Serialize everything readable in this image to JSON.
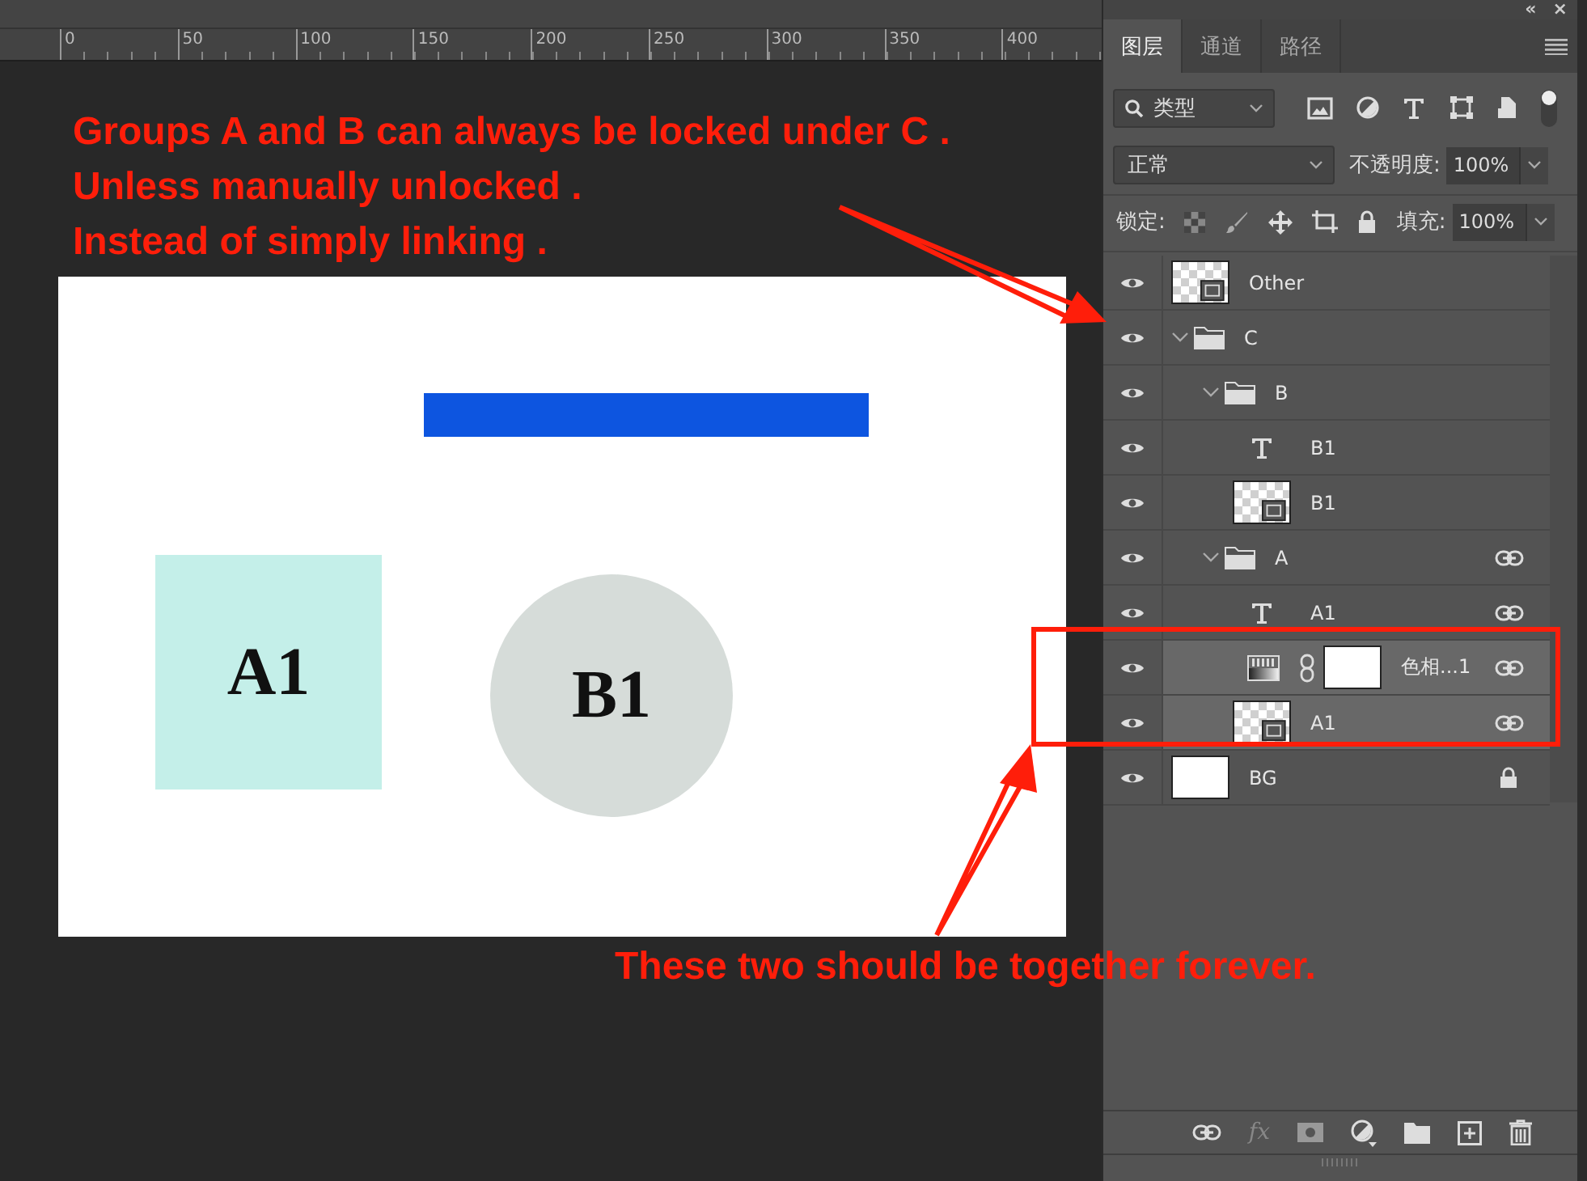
{
  "ruler": {
    "ticks": [
      "0",
      "50",
      "100",
      "150",
      "200",
      "250",
      "300",
      "350",
      "400"
    ]
  },
  "canvas": {
    "shapes": [
      {
        "kind": "bar"
      },
      {
        "kind": "square",
        "label": "A1"
      },
      {
        "kind": "circle",
        "label": "B1"
      }
    ]
  },
  "panel": {
    "header_buttons": [
      "«",
      "×"
    ],
    "tabs": [
      {
        "label": "图层",
        "selected": true
      },
      {
        "label": "通道",
        "selected": false
      },
      {
        "label": "路径",
        "selected": false
      }
    ],
    "filter": {
      "value": "类型"
    },
    "blend_mode": "正常",
    "opacity_label": "不透明度:",
    "opacity": "100%",
    "lock_label": "锁定:",
    "fill_label": "填充:",
    "fill": "100%",
    "layers": [
      {
        "kind": "shape",
        "name": "Other",
        "selected": false,
        "linked": false,
        "locked": false
      },
      {
        "kind": "group",
        "name": "C",
        "expanded": true,
        "selected": false,
        "linked": false,
        "locked": false,
        "children": [
          {
            "kind": "group",
            "name": "B",
            "expanded": true,
            "selected": false,
            "linked": false,
            "locked": false,
            "children": [
              {
                "kind": "text",
                "name": "B1",
                "selected": false,
                "linked": false,
                "locked": false
              },
              {
                "kind": "shape",
                "name": "B1",
                "selected": false,
                "linked": false,
                "locked": false
              }
            ]
          },
          {
            "kind": "group",
            "name": "A",
            "expanded": true,
            "selected": false,
            "linked": true,
            "locked": false,
            "children": [
              {
                "kind": "text",
                "name": "A1",
                "selected": false,
                "linked": true,
                "locked": false
              },
              {
                "kind": "adjustment",
                "name": "色相...1",
                "selected": true,
                "linked": true,
                "locked": false
              },
              {
                "kind": "shape",
                "name": "A1",
                "selected": true,
                "linked": true,
                "locked": false
              }
            ]
          }
        ]
      },
      {
        "kind": "fill",
        "name": "BG",
        "selected": false,
        "linked": false,
        "locked": true
      }
    ],
    "toolbar": {
      "fx_label": "fx"
    }
  },
  "annotations": [
    {
      "kind": "top",
      "lines": [
        "Groups A and B can always be locked under C .",
        "Unless manually unlocked .",
        "Instead of simply linking ."
      ]
    },
    {
      "kind": "bottom",
      "lines": [
        "These two should be together forever."
      ]
    }
  ]
}
